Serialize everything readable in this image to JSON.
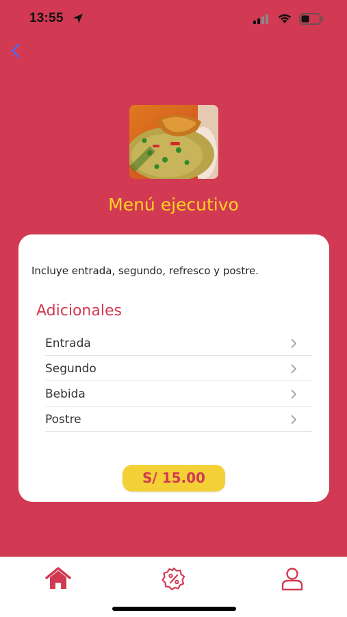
{
  "status_bar": {
    "time": "13:55"
  },
  "nav": {
    "back_icon": "chevron-left-icon"
  },
  "product": {
    "title": "Menú ejecutivo",
    "description": "Incluye entrada, segundo, refresco y postre.",
    "image": "arroz-con-pollo-photo"
  },
  "additionals": {
    "title": "Adicionales",
    "items": [
      {
        "label": "Entrada"
      },
      {
        "label": "Segundo"
      },
      {
        "label": "Bebida"
      },
      {
        "label": "Postre"
      }
    ]
  },
  "price": {
    "label": "S/ 15.00"
  },
  "tab_bar": {
    "tabs": [
      {
        "icon": "home-icon",
        "active": true
      },
      {
        "icon": "discount-badge-icon",
        "active": false
      },
      {
        "icon": "user-icon",
        "active": false
      }
    ]
  },
  "colors": {
    "primary": "#d13a52",
    "accent_yellow": "#ffd21f",
    "button_yellow": "#f4d037",
    "back_arrow": "#4a6cf7"
  }
}
